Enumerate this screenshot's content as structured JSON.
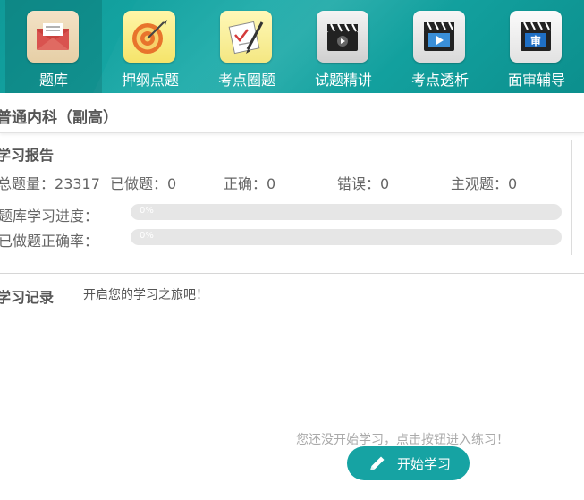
{
  "nav": {
    "items": [
      {
        "label": "题库",
        "icon": "envelope-icon"
      },
      {
        "label": "押纲点题",
        "icon": "target-icon"
      },
      {
        "label": "考点圈题",
        "icon": "pencil-check-icon"
      },
      {
        "label": "试题精讲",
        "icon": "clapperboard-play-icon"
      },
      {
        "label": "考点透析",
        "icon": "clapperboard-screen-icon"
      },
      {
        "label": "面审辅导",
        "icon": "clapperboard-shen-icon"
      }
    ],
    "shen_char": "审"
  },
  "subject": {
    "title": "普通内科（副高）"
  },
  "report": {
    "title": "学习报告",
    "stats": [
      {
        "label": "总题量：",
        "value": "23317"
      },
      {
        "label": "已做题：",
        "value": "0"
      },
      {
        "label": "正确：",
        "value": "0"
      },
      {
        "label": "错误：",
        "value": "0"
      },
      {
        "label": "主观题：",
        "value": "0"
      }
    ],
    "progress": [
      {
        "label": "题库学习进度：",
        "text": "0%",
        "percent": 0
      },
      {
        "label": "已做题正确率：",
        "text": "0%",
        "percent": 0
      }
    ]
  },
  "record": {
    "title": "学习记录",
    "hint": "开启您的学习之旅吧！"
  },
  "empty_hint": "您还没开始学习，点击按钮进入练习！",
  "start_button": {
    "label": "开始学习",
    "icon": "pencil-icon"
  },
  "colors": {
    "nav_bg": "#129f9d",
    "button_bg": "#16a3a3",
    "progress_track": "#e6e6e6"
  }
}
